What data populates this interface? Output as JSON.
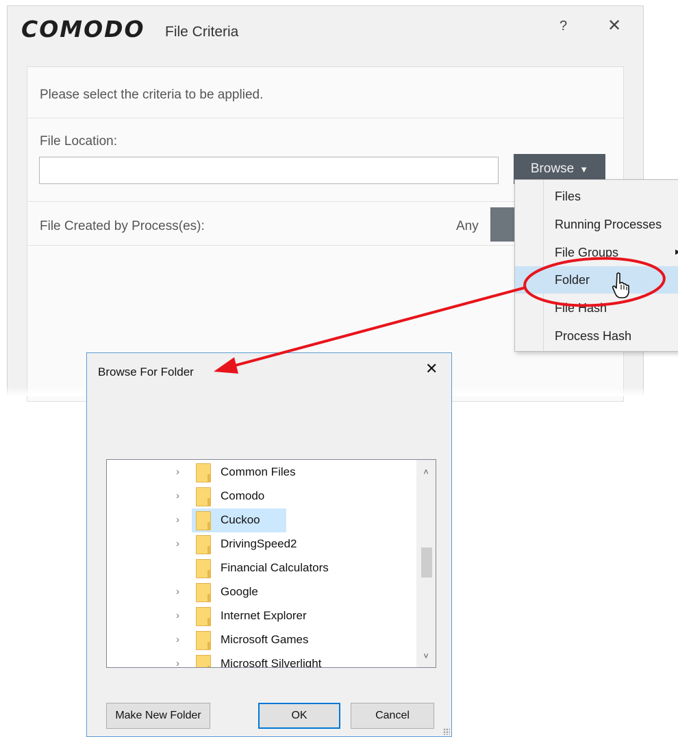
{
  "main_dialog": {
    "brand": "COMODO",
    "title": "File Criteria",
    "help_glyph": "?",
    "close_glyph": "✕",
    "instruction": "Please select the criteria to be applied.",
    "file_location_label": "File Location:",
    "file_location_value": "",
    "browse_label": "Browse",
    "browse_arrow": "▼",
    "created_by_label": "File Created by Process(es):",
    "any_label": "Any"
  },
  "browse_menu": {
    "items": [
      {
        "label": "Files"
      },
      {
        "label": "Running Processes"
      },
      {
        "label": "File Groups",
        "submenu_arrow": "▶"
      },
      {
        "label": "Folder"
      },
      {
        "label": "File Hash"
      },
      {
        "label": "Process Hash"
      }
    ],
    "hovered_item": "Folder"
  },
  "folder_dialog": {
    "title": "Browse For Folder",
    "close_glyph": "✕",
    "tree_items": [
      {
        "label": "Common Files",
        "expand": "›"
      },
      {
        "label": "Comodo",
        "expand": "›"
      },
      {
        "label": "Cuckoo",
        "expand": "›",
        "selected": true
      },
      {
        "label": "DrivingSpeed2",
        "expand": "›"
      },
      {
        "label": "Financial Calculators",
        "expand": ""
      },
      {
        "label": "Google",
        "expand": "›"
      },
      {
        "label": "Internet Explorer",
        "expand": "›"
      },
      {
        "label": "Microsoft Games",
        "expand": "›"
      },
      {
        "label": "Microsoft Silverlight",
        "expand": "›"
      }
    ],
    "scroll_up": "˄",
    "scroll_down": "˅",
    "make_new_folder_label": "Make New Folder",
    "ok_label": "OK",
    "cancel_label": "Cancel"
  },
  "colors": {
    "annotation_red": "#e8141c",
    "browse_button": "#535b65",
    "menu_hover": "#cce3f5",
    "tree_selection": "#cce8ff",
    "dialog_border_accent": "#5a9bd5"
  }
}
